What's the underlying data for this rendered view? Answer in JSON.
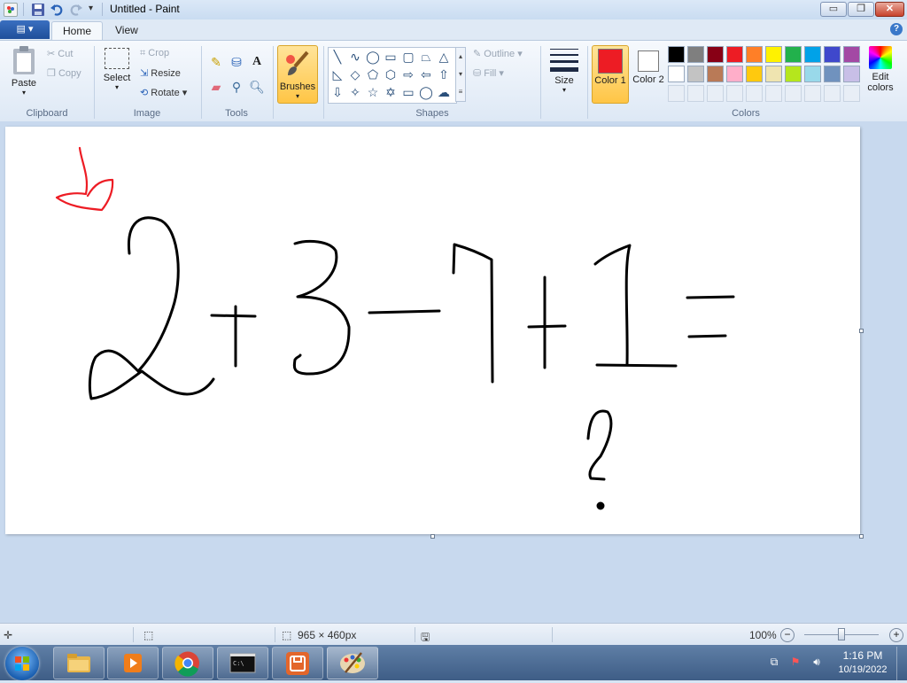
{
  "window": {
    "title": "Untitled - Paint",
    "minimize": "▭",
    "restore": "❐",
    "close": "✕"
  },
  "tabs": {
    "file_menu": "▤ ▾",
    "home": "Home",
    "view": "View",
    "help": "?"
  },
  "ribbon": {
    "clipboard": {
      "paste": "Paste",
      "cut": "Cut",
      "copy": "Copy",
      "label": "Clipboard"
    },
    "image": {
      "select": "Select",
      "crop": "Crop",
      "resize": "Resize",
      "rotate": "Rotate",
      "label": "Image"
    },
    "tools": {
      "label": "Tools",
      "text_tool": "A"
    },
    "brushes": {
      "label": "Brushes"
    },
    "shapes": {
      "outline": "Outline",
      "fill": "Fill",
      "label": "Shapes"
    },
    "size": {
      "label": "Size"
    },
    "colors": {
      "color1": "Color 1",
      "color2": "Color 2",
      "edit": "Edit colors",
      "label": "Colors",
      "color1_value": "#ed1c24",
      "color2_value": "#ffffff",
      "palette_row1": [
        "#000000",
        "#7f7f7f",
        "#880015",
        "#ed1c24",
        "#ff7f27",
        "#fff200",
        "#22b14c",
        "#00a2e8",
        "#3f48cc",
        "#a349a4"
      ],
      "palette_row2": [
        "#ffffff",
        "#c3c3c3",
        "#b97a57",
        "#ffaec9",
        "#ffc90e",
        "#efe4b0",
        "#b5e61d",
        "#99d9ea",
        "#7092be",
        "#c8bfe7"
      ]
    }
  },
  "status": {
    "canvas_size": "965 × 460px",
    "zoom": "100%"
  },
  "taskbar": {
    "time": "1:16 PM",
    "date": "10/19/2022"
  }
}
